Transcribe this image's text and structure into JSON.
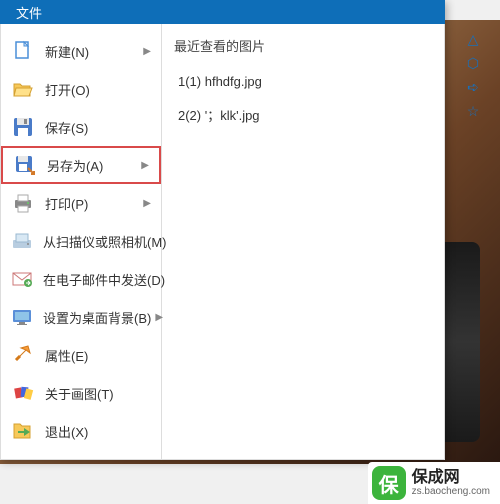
{
  "header": {
    "tab": "文件"
  },
  "menu": [
    {
      "icon": "new-doc",
      "label": "新建(N)",
      "arrow": true,
      "highlighted": false
    },
    {
      "icon": "open",
      "label": "打开(O)",
      "arrow": false,
      "highlighted": false
    },
    {
      "icon": "save",
      "label": "保存(S)",
      "arrow": false,
      "highlighted": false
    },
    {
      "icon": "saveas",
      "label": "另存为(A)",
      "arrow": true,
      "highlighted": true
    },
    {
      "icon": "print",
      "label": "打印(P)",
      "arrow": true,
      "highlighted": false
    },
    {
      "icon": "scanner",
      "label": "从扫描仪或照相机(M)",
      "arrow": false,
      "highlighted": false
    },
    {
      "icon": "email",
      "label": "在电子邮件中发送(D)",
      "arrow": false,
      "highlighted": false
    },
    {
      "icon": "wallpaper",
      "label": "设置为桌面背景(B)",
      "arrow": true,
      "highlighted": false
    },
    {
      "icon": "properties",
      "label": "属性(E)",
      "arrow": false,
      "highlighted": false
    },
    {
      "icon": "about",
      "label": "关于画图(T)",
      "arrow": false,
      "highlighted": false
    },
    {
      "icon": "exit",
      "label": "退出(X)",
      "arrow": false,
      "highlighted": false
    }
  ],
  "recent": {
    "header": "最近查看的图片",
    "items": [
      {
        "num": "1(1)",
        "name": "hfhdfg.jpg"
      },
      {
        "num": "2(2)",
        "name": "'；klk'.jpg"
      }
    ]
  },
  "toolbar": [
    {
      "name": "triangle-tool",
      "glyph": "△"
    },
    {
      "name": "hexagon-tool",
      "glyph": "⬡"
    },
    {
      "name": "arrow-tool",
      "glyph": "➪"
    },
    {
      "name": "star-tool",
      "glyph": "☆"
    }
  ],
  "watermark": {
    "badge": "保",
    "title": "保成网",
    "url": "zs.baocheng.com"
  }
}
